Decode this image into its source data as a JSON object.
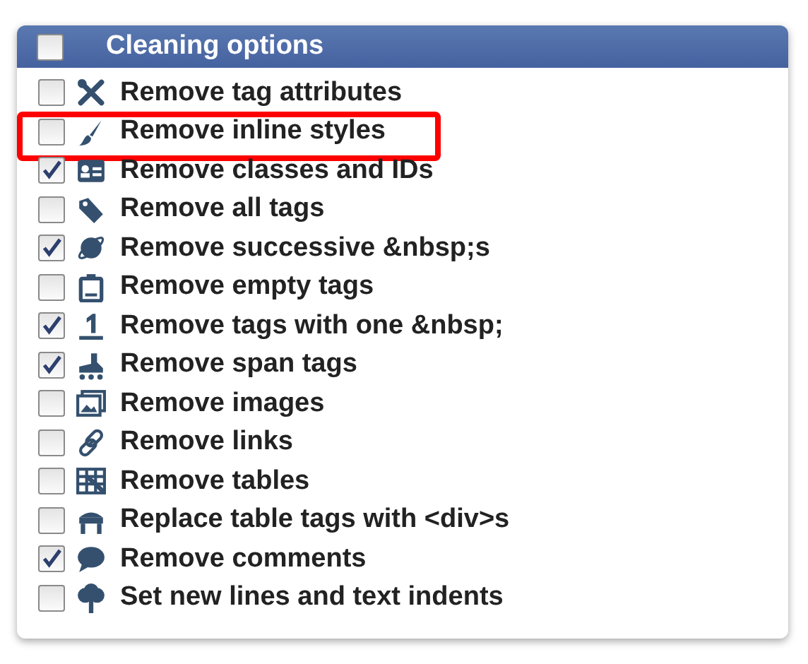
{
  "header": {
    "title": "Cleaning options",
    "checked": false
  },
  "options": [
    {
      "label": "Remove tag attributes",
      "checked": false,
      "highlighted": false
    },
    {
      "label": "Remove inline styles",
      "checked": false,
      "highlighted": true
    },
    {
      "label": "Remove classes and IDs",
      "checked": true,
      "highlighted": false
    },
    {
      "label": "Remove all tags",
      "checked": false,
      "highlighted": false
    },
    {
      "label": "Remove successive &nbsp;s",
      "checked": true,
      "highlighted": false
    },
    {
      "label": "Remove empty tags",
      "checked": false,
      "highlighted": false
    },
    {
      "label": "Remove tags with one &nbsp;",
      "checked": true,
      "highlighted": false
    },
    {
      "label": "Remove span tags",
      "checked": true,
      "highlighted": false
    },
    {
      "label": "Remove images",
      "checked": false,
      "highlighted": false
    },
    {
      "label": "Remove links",
      "checked": false,
      "highlighted": false
    },
    {
      "label": "Remove tables",
      "checked": false,
      "highlighted": false
    },
    {
      "label": "Replace table tags with <div>s",
      "checked": false,
      "highlighted": false
    },
    {
      "label": "Remove comments",
      "checked": true,
      "highlighted": false
    },
    {
      "label": "Set new lines and text indents",
      "checked": false,
      "highlighted": false
    }
  ]
}
